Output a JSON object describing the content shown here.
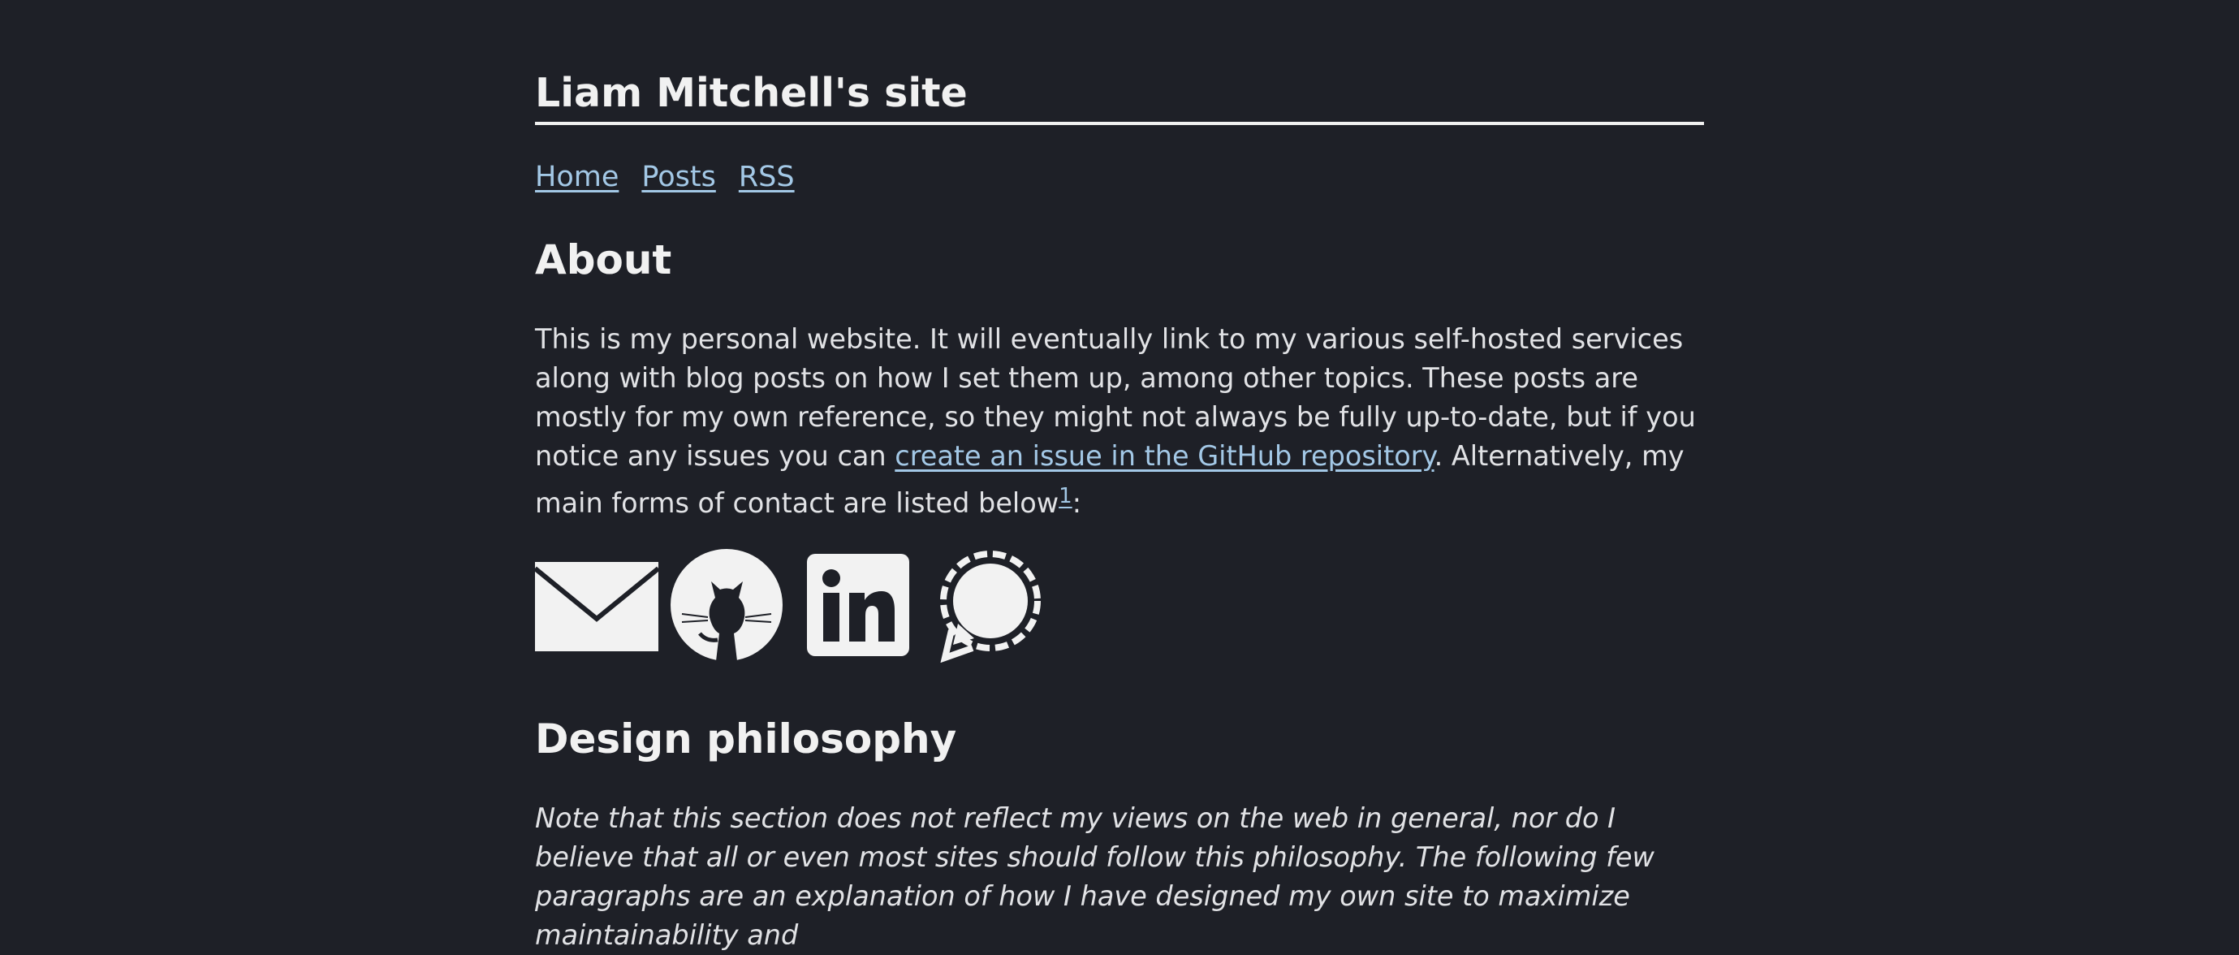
{
  "site": {
    "title": "Liam Mitchell's site"
  },
  "nav": {
    "home": "Home",
    "posts": "Posts",
    "rss": "RSS"
  },
  "about": {
    "heading": "About",
    "text_before_link": "This is my personal website. It will eventually link to my various self-hosted services along with blog posts on how I set them up, among other topics. These posts are mostly for my own reference, so they might not always be fully up-to-date, but if you notice any issues you can ",
    "link_text": "create an issue in the GitHub repository",
    "text_after_link": ". Alternatively, my main forms of contact are listed below",
    "footnote": "1",
    "text_end": ":"
  },
  "contacts": [
    {
      "icon": "email-icon"
    },
    {
      "icon": "github-icon"
    },
    {
      "icon": "linkedin-icon"
    },
    {
      "icon": "signal-icon"
    }
  ],
  "design": {
    "heading": "Design philosophy",
    "text": "Note that this section does not reflect my views on the web in general, nor do I believe that all or even most sites should follow this philosophy. The following few paragraphs are an explanation of how I have designed my own site to maximize maintainability and"
  },
  "colors": {
    "background": "#1e2027",
    "text": "#e7e8ea",
    "link": "#a3c8e6"
  }
}
